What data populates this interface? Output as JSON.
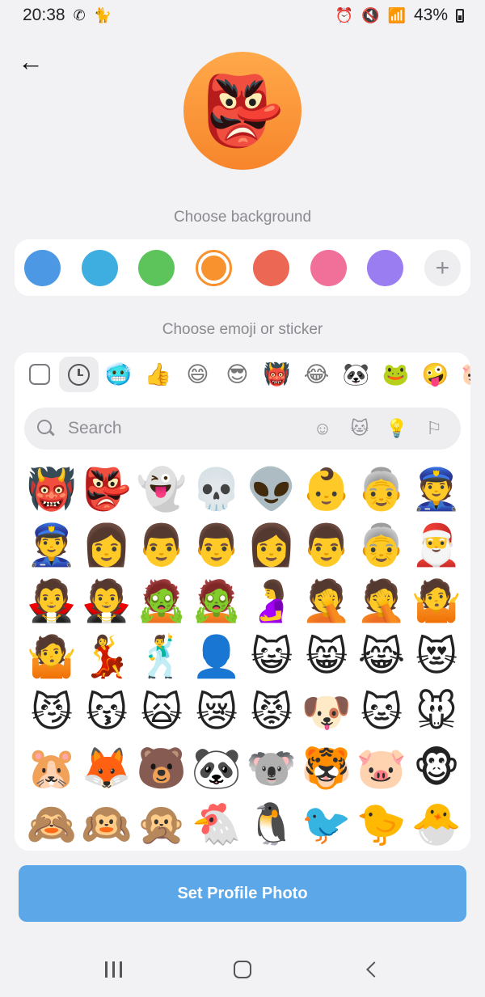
{
  "status_bar": {
    "time": "20:38",
    "battery": "43%",
    "left_icons": [
      "phone-icon",
      "animal-icon"
    ],
    "right_icons": [
      "alarm-icon",
      "mute-icon",
      "wifi-icon",
      "signal-icon",
      "battery-icon"
    ]
  },
  "header": {
    "back_icon": "arrow-left-icon",
    "back_glyph": "←"
  },
  "avatar": {
    "emoji": "👺",
    "background": "#f7922e"
  },
  "background_section": {
    "label": "Choose background",
    "swatches": [
      {
        "color": "#4d98e4",
        "name": "blue"
      },
      {
        "color": "#3eaee0",
        "name": "cyan"
      },
      {
        "color": "#5cc45a",
        "name": "green"
      },
      {
        "color": "#f7922e",
        "name": "orange",
        "selected": true
      },
      {
        "color": "#ec6754",
        "name": "red"
      },
      {
        "color": "#f0709a",
        "name": "pink"
      },
      {
        "color": "#9a7df0",
        "name": "purple"
      }
    ],
    "add_glyph": "+"
  },
  "emoji_section": {
    "label": "Choose emoji or sticker",
    "tabs": [
      "🥶",
      "👍",
      "😄",
      "😎",
      "👹",
      "😂",
      "🐼",
      "🐸",
      "🤪",
      "🐷"
    ],
    "search_placeholder": "Search",
    "category_icons": [
      {
        "name": "smiley-icon",
        "glyph": "☺"
      },
      {
        "name": "cat-icon",
        "glyph": "🐱"
      },
      {
        "name": "lightbulb-icon",
        "glyph": "💡"
      },
      {
        "name": "flag-icon",
        "glyph": "⚐"
      }
    ],
    "emojis": [
      "👹",
      "👺",
      "👻",
      "💀",
      "👽",
      "👶",
      "👵",
      "👮",
      "👮",
      "👩",
      "👨",
      "👨",
      "👩",
      "👨",
      "👵",
      "🎅",
      "🧛",
      "🧛",
      "🧟",
      "🧟",
      "🤰",
      "🤦",
      "🤦",
      "🤷",
      "🤷",
      "💃",
      "🕺",
      "👤",
      "😺",
      "😸",
      "😹",
      "😻",
      "😼",
      "😽",
      "🙀",
      "😿",
      "😾",
      "🐶",
      "🐱",
      "🐭",
      "🐹",
      "🦊",
      "🐻",
      "🐼",
      "🐨",
      "🐯",
      "🐷",
      "🐵",
      "🙈",
      "🙉",
      "🙊",
      "🐔",
      "🐧",
      "🐦",
      "🐤",
      "🐣"
    ]
  },
  "primary_button": {
    "label": "Set Profile Photo",
    "color": "#5ba7e8"
  }
}
